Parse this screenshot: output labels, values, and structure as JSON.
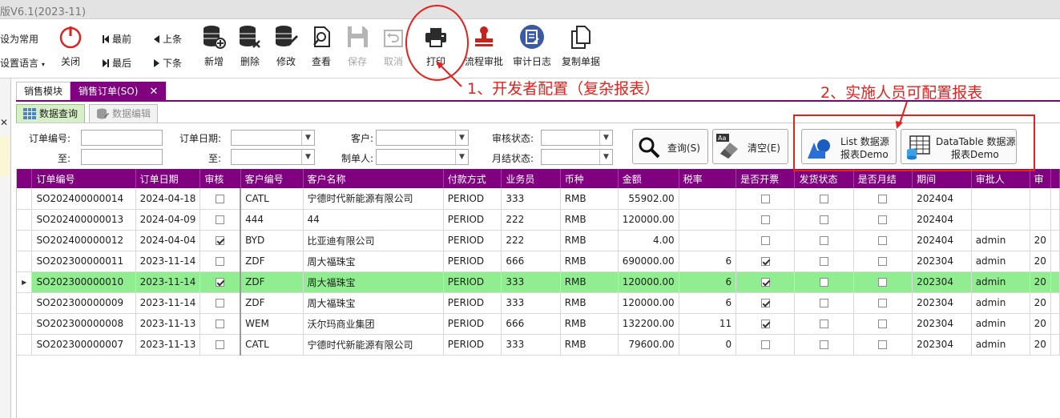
{
  "app": {
    "title": "版V6.1(2023-11)"
  },
  "ribbon": {
    "set_common": "设为常用",
    "set_language": "设置语言",
    "close": "关闭",
    "first": "最前",
    "last": "最后",
    "prev": "上条",
    "next": "下条",
    "add": "新增",
    "delete": "删除",
    "edit": "修改",
    "view": "查看",
    "save": "保存",
    "cancel": "取消",
    "print": "打印",
    "workflow": "流程审批",
    "audit_log": "审计日志",
    "copy_doc": "复制单据"
  },
  "doc_tabs": [
    {
      "label": "销售模块"
    },
    {
      "label": "销售订单(SO)"
    }
  ],
  "inner_tabs": [
    {
      "label": "数据查询"
    },
    {
      "label": "数据编辑"
    }
  ],
  "query": {
    "order_no": "订单编号:",
    "to1": "至:",
    "order_date": "订单日期:",
    "to2": "至:",
    "customer": "客户:",
    "creator": "制单人:",
    "audit_status": "审核状态:",
    "month_status": "月结状态:",
    "search_btn": "查询(S)",
    "clear_btn": "清空(E)",
    "list_demo_1": "List 数据源",
    "list_demo_2": "报表Demo",
    "dt_demo_1": "DataTable 数据源",
    "dt_demo_2": "报表Demo"
  },
  "annotations": {
    "a1": "1、开发者配置（复杂报表）",
    "a2": "2、实施人员可配置报表"
  },
  "table": {
    "columns": [
      "订单编号",
      "订单日期",
      "审核",
      "客户编号",
      "客户名称",
      "付款方式",
      "业务员",
      "币种",
      "金额",
      "税率",
      "是否开票",
      "发货状态",
      "是否月结",
      "期间",
      "审批人",
      "审"
    ],
    "rows": [
      {
        "no": "SO202400000014",
        "date": "2024-04-18",
        "audit": false,
        "cust": "CATL",
        "name": "宁德时代新能源有限公司",
        "pay": "PERIOD",
        "sales": "333",
        "cur": "RMB",
        "amt": "55902.00",
        "tax": "",
        "inv": false,
        "ship": false,
        "month": false,
        "period": "202404",
        "approver": "",
        "extra": ""
      },
      {
        "no": "SO202400000013",
        "date": "2024-04-09",
        "audit": false,
        "cust": "444",
        "name": "44",
        "pay": "PERIOD",
        "sales": "222",
        "cur": "RMB",
        "amt": "120000.00",
        "tax": "",
        "inv": false,
        "ship": false,
        "month": false,
        "period": "202404",
        "approver": "",
        "extra": ""
      },
      {
        "no": "SO202400000012",
        "date": "2024-04-04",
        "audit": true,
        "cust": "BYD",
        "name": "比亚迪有限公司",
        "pay": "PERIOD",
        "sales": "222",
        "cur": "RMB",
        "amt": "4.00",
        "tax": "",
        "inv": false,
        "ship": false,
        "month": false,
        "period": "202404",
        "approver": "admin",
        "extra": "20"
      },
      {
        "no": "SO202300000011",
        "date": "2023-11-14",
        "audit": false,
        "cust": "ZDF",
        "name": "周大福珠宝",
        "pay": "PERIOD",
        "sales": "666",
        "cur": "RMB",
        "amt": "690000.00",
        "tax": "6",
        "inv": true,
        "ship": false,
        "month": false,
        "period": "202304",
        "approver": "admin",
        "extra": "20"
      },
      {
        "no": "SO202300000010",
        "date": "2023-11-14",
        "audit": true,
        "cust": "ZDF",
        "name": "周大福珠宝",
        "pay": "PERIOD",
        "sales": "333",
        "cur": "RMB",
        "amt": "120000.00",
        "tax": "6",
        "inv": true,
        "ship": false,
        "month": false,
        "period": "202304",
        "approver": "admin",
        "extra": "20"
      },
      {
        "no": "SO202300000009",
        "date": "2023-11-14",
        "audit": false,
        "cust": "ZDF",
        "name": "周大福珠宝",
        "pay": "PERIOD",
        "sales": "333",
        "cur": "RMB",
        "amt": "120000.00",
        "tax": "6",
        "inv": true,
        "ship": false,
        "month": false,
        "period": "202304",
        "approver": "admin",
        "extra": "20"
      },
      {
        "no": "SO202300000008",
        "date": "2023-11-13",
        "audit": false,
        "cust": "WEM",
        "name": "沃尔玛商业集团",
        "pay": "PERIOD",
        "sales": "666",
        "cur": "RMB",
        "amt": "132200.00",
        "tax": "11",
        "inv": true,
        "ship": false,
        "month": false,
        "period": "202304",
        "approver": "admin",
        "extra": "20"
      },
      {
        "no": "SO202300000007",
        "date": "2023-11-13",
        "audit": false,
        "cust": "CATL",
        "name": "宁德时代新能源有限公司",
        "pay": "PERIOD",
        "sales": "333",
        "cur": "RMB",
        "amt": "79600.00",
        "tax": "0",
        "inv": false,
        "ship": false,
        "month": false,
        "period": "202304",
        "approver": "admin",
        "extra": "20"
      }
    ],
    "selected_row": 4
  },
  "colors": {
    "accent": "#800080",
    "selected": "#90ee90",
    "annotation": "#e8201d"
  }
}
